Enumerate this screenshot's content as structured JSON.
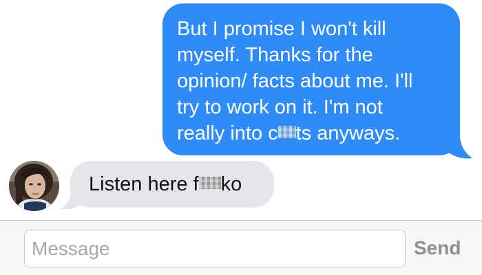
{
  "conversation": {
    "outgoing": {
      "lines": [
        "But I promise I won't kill",
        "myself. Thanks for the",
        "opinion/ facts about me. I'll",
        "try to work on it. I'm not"
      ],
      "last_line_start": "really into c",
      "last_line_end": "ts anyways."
    },
    "incoming": {
      "text_start": "Listen here f",
      "text_end": "ko"
    }
  },
  "composer": {
    "placeholder": "Message",
    "send_label": "Send"
  },
  "colors": {
    "outgoing_bubble": "#2f8bf6",
    "incoming_bubble": "#e5e5ea",
    "send_disabled": "#8e8e93",
    "composer_background": "#f6f6f7"
  },
  "icons": {
    "avatar": "contact-avatar"
  }
}
